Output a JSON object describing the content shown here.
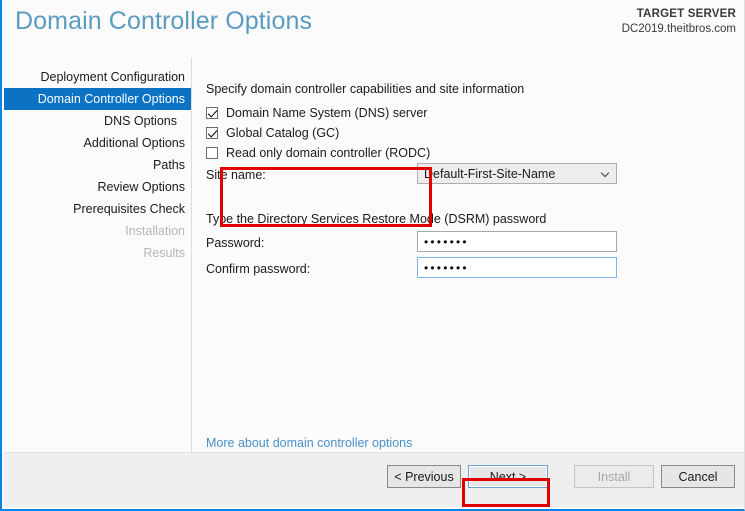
{
  "window": {
    "title": "Domain Controller Options",
    "target_label": "TARGET SERVER",
    "target_server": "DC2019.theitbros.com",
    "accent_color": "#0b72c4",
    "border_color": "#0a84e0",
    "annotation_color": "#e00000"
  },
  "sidebar": {
    "items": [
      {
        "label": "Deployment Configuration",
        "state": "normal"
      },
      {
        "label": "Domain Controller Options",
        "state": "selected"
      },
      {
        "label": "DNS Options",
        "state": "indent"
      },
      {
        "label": "Additional Options",
        "state": "normal"
      },
      {
        "label": "Paths",
        "state": "normal"
      },
      {
        "label": "Review Options",
        "state": "normal"
      },
      {
        "label": "Prerequisites Check",
        "state": "normal"
      },
      {
        "label": "Installation",
        "state": "disabled"
      },
      {
        "label": "Results",
        "state": "disabled"
      }
    ]
  },
  "main": {
    "capabilities_heading": "Specify domain controller capabilities and site information",
    "checkboxes": [
      {
        "label": "Domain Name System (DNS) server",
        "checked": true
      },
      {
        "label": "Global Catalog (GC)",
        "checked": true
      },
      {
        "label": "Read only domain controller (RODC)",
        "checked": false
      }
    ],
    "site_name_label": "Site name:",
    "site_name_value": "Default-First-Site-Name",
    "dsrm_heading": "Type the Directory Services Restore Mode (DSRM) password",
    "password_label": "Password:",
    "password_value": "•••••••",
    "confirm_password_label": "Confirm password:",
    "confirm_password_value": "•••••••",
    "help_link": "More about domain controller options"
  },
  "footer": {
    "previous_label": "< Previous",
    "next_label": "Next >",
    "install_label": "Install",
    "cancel_label": "Cancel"
  }
}
